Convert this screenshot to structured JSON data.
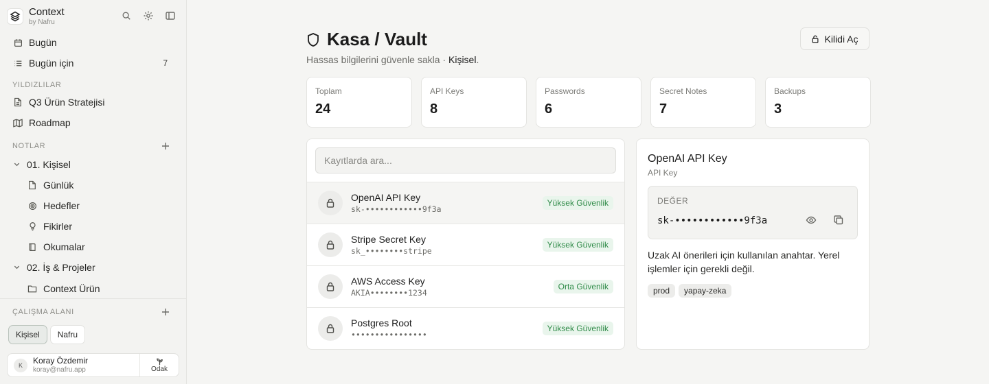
{
  "app": {
    "name": "Context",
    "subtitle": "by Nafru"
  },
  "sidebar": {
    "today": "Bugün",
    "for_today": {
      "label": "Bugün için",
      "count": "7"
    },
    "starred_label": "YILDIZLILAR",
    "starred": [
      "Q3 Ürün Stratejisi",
      "Roadmap"
    ],
    "notes_label": "NOTLAR",
    "folders": [
      {
        "label": "01. Kişisel",
        "children": [
          "Günlük",
          "Hedefler",
          "Fikirler",
          "Okumalar"
        ]
      },
      {
        "label": "02. İş & Projeler",
        "children": [
          "Context Ürün"
        ]
      }
    ],
    "workspace_label": "ÇALIŞMA ALANI",
    "workspaces": [
      "Kişisel",
      "Nafru"
    ],
    "user": {
      "initial": "K",
      "name": "Koray Özdemir",
      "email": "koray@nafru.app"
    },
    "focus_label": "Odak"
  },
  "header": {
    "title": "Kasa / Vault",
    "subtitle_prefix": "Hassas bilgilerini güvenle sakla · ",
    "subtitle_highlight": "Kişisel",
    "subtitle_suffix": ".",
    "unlock_label": "Kilidi Aç"
  },
  "stats": [
    {
      "label": "Toplam",
      "value": "24"
    },
    {
      "label": "API Keys",
      "value": "8"
    },
    {
      "label": "Passwords",
      "value": "6"
    },
    {
      "label": "Secret Notes",
      "value": "7"
    },
    {
      "label": "Backups",
      "value": "3"
    }
  ],
  "search": {
    "placeholder": "Kayıtlarda ara..."
  },
  "entries": [
    {
      "title": "OpenAI API Key",
      "masked": "sk-••••••••••••9f3a",
      "level": "Yüksek Güvenlik"
    },
    {
      "title": "Stripe Secret Key",
      "masked": "sk_••••••••stripe",
      "level": "Yüksek Güvenlik"
    },
    {
      "title": "AWS Access Key",
      "masked": "AKIA••••••••1234",
      "level": "Orta Güvenlik"
    },
    {
      "title": "Postgres Root",
      "masked": "••••••••••••••••",
      "level": "Yüksek Güvenlik"
    }
  ],
  "detail": {
    "title": "OpenAI API Key",
    "type": "API Key",
    "value_label": "DEĞER",
    "value": "sk-••••••••••••9f3a",
    "description": "Uzak AI önerileri için kullanılan anahtar. Yerel işlemler için gerekli değil.",
    "tags": [
      "prod",
      "yapay-zeka"
    ]
  },
  "colors": {
    "badge_bg": "#e9f5ec",
    "badge_text": "#2e8a47",
    "accent": "#1c1c1c"
  }
}
